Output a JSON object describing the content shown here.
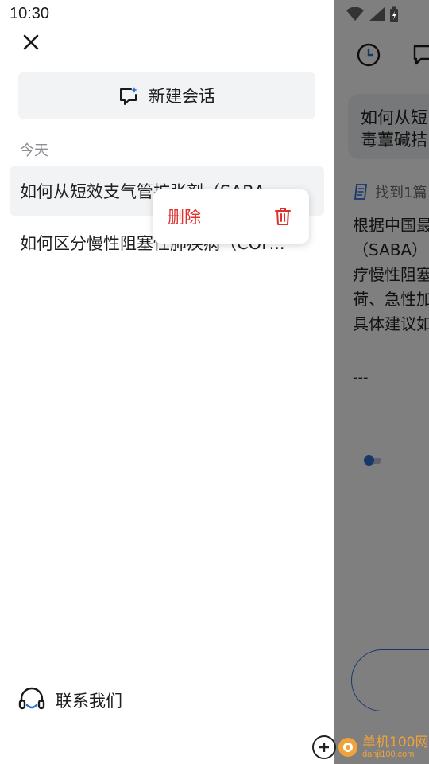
{
  "status_bar": {
    "time": "10:30"
  },
  "drawer": {
    "new_chat_label": "新建会话",
    "section_today": "今天",
    "history": [
      {
        "title": "如何从短效支气管扩张剂（SABA..."
      },
      {
        "title": "如何区分慢性阻塞性肺疾病（COP..."
      }
    ],
    "context_menu": {
      "delete_label": "删除"
    },
    "contact_label": "联系我们"
  },
  "background": {
    "question_bubble": [
      "如何从短",
      "毒蕈碱拮"
    ],
    "found_text": "找到1篇",
    "answer_lines": [
      "根据中国最",
      "（SABA）",
      "疗慢性阻塞",
      "荷、急性加",
      "具体建议如"
    ],
    "separator": "---"
  },
  "watermark": {
    "text": "单机100网",
    "sub": "danji100.com"
  },
  "colors": {
    "accent": "#2f6fd6",
    "danger": "#e0302d",
    "watermark": "#f0a33a"
  }
}
